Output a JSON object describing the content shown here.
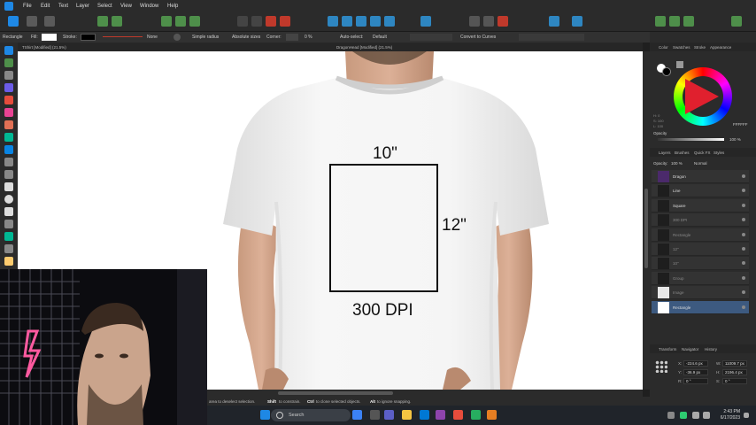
{
  "menubar": {
    "items": [
      "File",
      "Edit",
      "Text",
      "Layer",
      "Select",
      "View",
      "Window",
      "Help"
    ]
  },
  "contextbar": {
    "tool": "Rectangle",
    "fill_label": "Fill:",
    "stroke_label": "Stroke:",
    "stroke_value": "None",
    "simple_radius": "Simple radius",
    "absolute_sizes": "Absolute sizes",
    "corner_label": "Corner:",
    "corner_value": "0 %",
    "auto_select": "Auto-select:",
    "auto_select_value": "Default",
    "convert_to_curves": "Convert to Curves",
    "fill_color": "#ffffff",
    "stroke_color": "#000000"
  },
  "tabs": {
    "left_doc": "TShirt [Modified] (21.5%)",
    "right_doc": "DragonHead [Modified] (21.5%)"
  },
  "canvas": {
    "width_label": "10\"",
    "height_label": "12\"",
    "dpi_label": "300 DPI"
  },
  "status": {
    "text": "area to deselect selection.",
    "shift_key": "Shift",
    "shift_text": "to constrain.",
    "ctrl_key": "Ctrl",
    "ctrl_text": "to clone selected objects.",
    "alt_key": "Alt",
    "alt_text": "to ignore snapping."
  },
  "color_panel": {
    "tabs": [
      "Color",
      "Swatches",
      "Stroke",
      "Appearance"
    ],
    "hex_value": "FFFFFF",
    "h_value": "H: 0",
    "s_value": "S: 100",
    "l_value": "L: 100",
    "opacity_label": "Opacity",
    "opacity_value": "100 %"
  },
  "layers_panel": {
    "tabs": [
      "Layers",
      "Brushes",
      "Quick FX",
      "Styles"
    ],
    "opacity_label": "Opacity:",
    "opacity_value": "100 %",
    "blend_mode": "Normal",
    "items": [
      {
        "label": "Dragon",
        "dim": false,
        "selected": false
      },
      {
        "label": "Line",
        "dim": false,
        "selected": false
      },
      {
        "label": "Square",
        "dim": false,
        "selected": false
      },
      {
        "label": "300 DPI",
        "dim": true,
        "selected": false
      },
      {
        "label": "Rectangle",
        "dim": true,
        "selected": false
      },
      {
        "label": "12\"",
        "dim": true,
        "selected": false
      },
      {
        "label": "10\"",
        "dim": true,
        "selected": false
      },
      {
        "label": "Group",
        "dim": true,
        "selected": false
      },
      {
        "label": "Image",
        "dim": true,
        "selected": false
      },
      {
        "label": "Rectangle",
        "dim": false,
        "selected": true
      }
    ]
  },
  "transform_panel": {
    "tabs": [
      "Transform",
      "Navigator",
      "History"
    ],
    "x_label": "X:",
    "x_value": "-224.6 px",
    "y_label": "Y:",
    "y_value": "-36.9 px",
    "w_label": "W:",
    "w_value": "11009.7 px",
    "h_label": "H:",
    "h_value": "2196.4 px",
    "r_label": "R:",
    "r_value": "0 °",
    "s_label": "S:",
    "s_value": "0 °"
  },
  "taskbar": {
    "search_placeholder": "Search",
    "time": "2:43 PM",
    "date": "6/17/2023"
  }
}
